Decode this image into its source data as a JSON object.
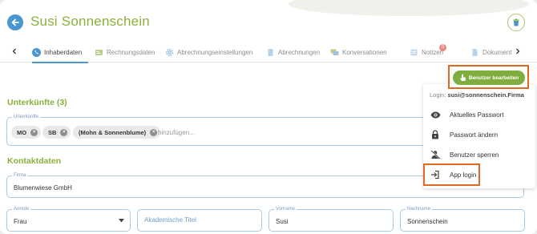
{
  "header": {
    "title": "Susi Sonnenschein"
  },
  "tabs": [
    {
      "label": "Inhaberdaten",
      "icon": "phone-icon"
    },
    {
      "label": "Rechnungsdaten",
      "icon": "invoice-icon"
    },
    {
      "label": "Abrechnungseinstellungen",
      "icon": "gear-icon"
    },
    {
      "label": "Abrechnungen",
      "icon": "document-icon"
    },
    {
      "label": "Konversationen",
      "icon": "chat-icon"
    },
    {
      "label": "Notizen",
      "icon": "note-icon",
      "badge": "0"
    },
    {
      "label": "Dokument",
      "icon": "file-icon"
    }
  ],
  "accommodations": {
    "section_title": "Unterkünfte (3)",
    "field_label": "Unterkünfte",
    "chips": [
      "MO",
      "SB",
      "(Mohn & Sonnenblume)"
    ],
    "add_placeholder": "hinzufügen..."
  },
  "contact": {
    "section_title": "Kontaktdaten",
    "company_label": "Firma",
    "company_value": "Blumenwiese GmbH",
    "salutation_label": "Anrede",
    "salutation_value": "Frau",
    "title_placeholder": "Akademische Titel",
    "firstname_label": "Vorname",
    "firstname_value": "Susi",
    "lastname_label": "Nachname",
    "lastname_value": "Sonnenschein"
  },
  "menu": {
    "edit_button": "Benutzer bearbeiten",
    "login_label": "Login:",
    "login_value": "susi@sonnenschein.Firma",
    "items": [
      {
        "label": "Aktuelles Passwort",
        "icon": "eye-icon"
      },
      {
        "label": "Passwort ändern",
        "icon": "lock-icon"
      },
      {
        "label": "Benutzer sperren",
        "icon": "user-block-icon"
      },
      {
        "label": "App login",
        "icon": "login-icon"
      }
    ]
  },
  "colors": {
    "accent_green": "#8ab13a",
    "accent_blue": "#4a97cf",
    "highlight": "#e06a1f",
    "button_green": "#7fae3f"
  }
}
